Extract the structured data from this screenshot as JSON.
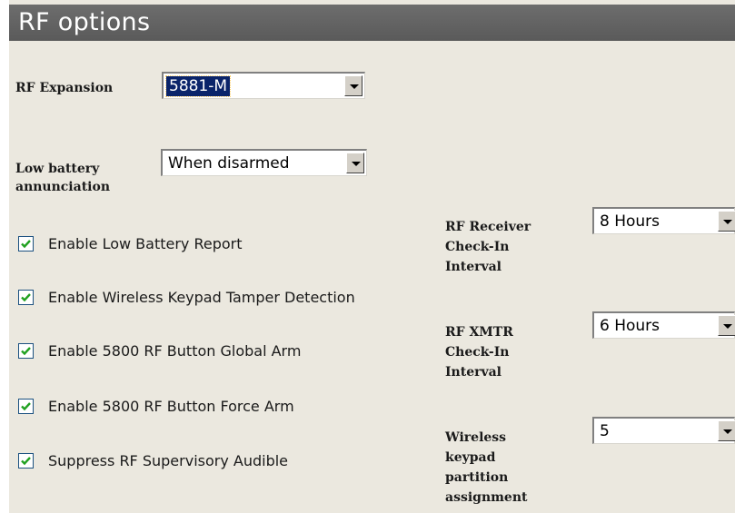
{
  "header": {
    "title": "RF options"
  },
  "rf_expansion": {
    "label": "RF Expansion",
    "value": "5881-M"
  },
  "low_battery": {
    "label_line1": "Low battery",
    "label_line2": "annunciation",
    "value": "When disarmed"
  },
  "checkboxes": [
    {
      "label": "Enable Low Battery Report",
      "checked": true
    },
    {
      "label": "Enable Wireless Keypad Tamper Detection",
      "checked": true
    },
    {
      "label": "Enable 5800 RF Button Global Arm",
      "checked": true
    },
    {
      "label": "Enable 5800 RF Button Force Arm",
      "checked": true
    },
    {
      "label": "Suppress RF Supervisory Audible",
      "checked": true
    }
  ],
  "receiver_checkin": {
    "line1": "RF Receiver",
    "line2": "Check-In",
    "line3": "Interval",
    "value": "8 Hours"
  },
  "xmtr_checkin": {
    "line1": "RF XMTR",
    "line2": "Check-In",
    "line3": "Interval",
    "value": "6 Hours"
  },
  "keypad_partition": {
    "line1": "Wireless",
    "line2": "keypad",
    "line3": "partition",
    "line4": "assignment",
    "value": "5"
  },
  "colors": {
    "header_bg": "#5f5f5f",
    "panel_bg": "#ebe8df",
    "selection_bg": "#0a246a",
    "checkbox_border": "#1c5180",
    "check_mark": "#21a121"
  },
  "icons": {
    "dropdown": "chevron-down-icon",
    "check": "checkmark-icon"
  }
}
